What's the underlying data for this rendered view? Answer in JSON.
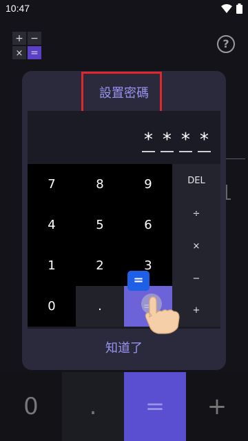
{
  "status": {
    "time": "10:47"
  },
  "app": {
    "help_label": "?",
    "bg_keys": {
      "zero": "0",
      "dot": ".",
      "equals": "=",
      "plus": "+"
    }
  },
  "dialog": {
    "title": "設置密碼",
    "password_mask": [
      "*",
      "*",
      "*",
      "*"
    ],
    "keys": {
      "k7": "7",
      "k8": "8",
      "k9": "9",
      "del": "DEL",
      "k4": "4",
      "k5": "5",
      "k6": "6",
      "divide": "÷",
      "k1": "1",
      "k2": "2",
      "k3": "3",
      "multiply": "×",
      "k0": "0",
      "dot": ".",
      "equals": "=",
      "minus": "−",
      "plus": "+"
    },
    "equals_badge": "=",
    "confirm_label": "知道了"
  },
  "colors": {
    "accent": "#9a93f0",
    "highlight_border": "#e0272b",
    "badge": "#1f5fe6"
  }
}
